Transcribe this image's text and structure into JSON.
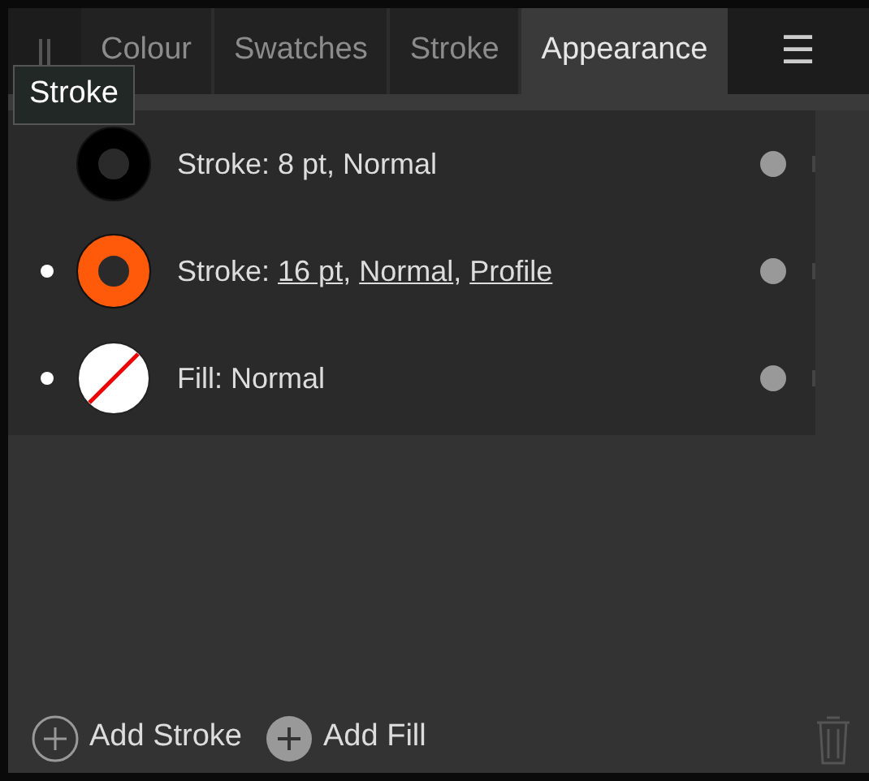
{
  "tabs": [
    {
      "label": "Colour",
      "selected": false
    },
    {
      "label": "Swatches",
      "selected": false
    },
    {
      "label": "Stroke",
      "selected": false
    },
    {
      "label": "Appearance",
      "selected": true
    }
  ],
  "menu_icon": "☰",
  "tooltip": "Stroke",
  "rows": [
    {
      "bullet": false,
      "swatch": {
        "kind": "ring",
        "color": "#000000"
      },
      "parts": [
        {
          "text": "Stroke: 8 pt, Normal",
          "link": false
        }
      ]
    },
    {
      "bullet": true,
      "swatch": {
        "kind": "ring",
        "color": "#ff5a0a"
      },
      "parts": [
        {
          "text": "Stroke: ",
          "link": false
        },
        {
          "text": "16 pt",
          "link": true,
          "after": ", "
        },
        {
          "text": "Normal",
          "link": true,
          "after": ", "
        },
        {
          "text": "Profile",
          "link": true
        }
      ]
    },
    {
      "bullet": true,
      "swatch": {
        "kind": "none"
      },
      "parts": [
        {
          "text": "Fill: Normal",
          "link": false
        }
      ]
    }
  ],
  "footer": [
    {
      "label": "Add Stroke",
      "kind": "outline"
    },
    {
      "label": "Add Fill",
      "kind": "filled"
    }
  ],
  "delete_disabled": true
}
